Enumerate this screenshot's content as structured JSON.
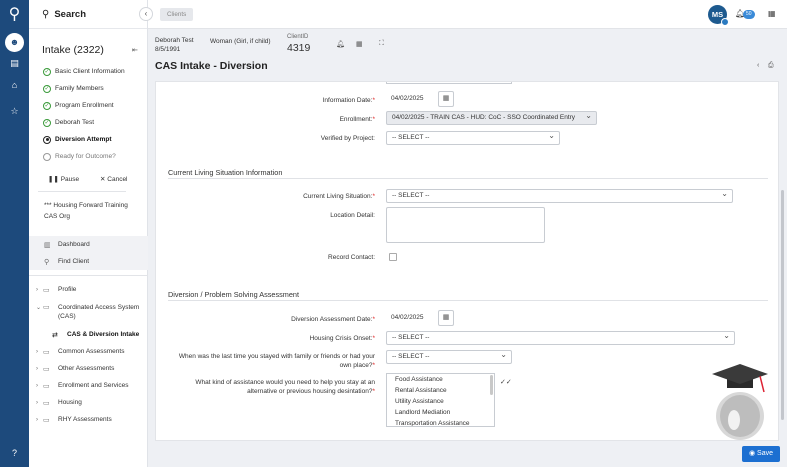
{
  "sidebar": {
    "search_label": "Search",
    "intake_title": "Intake (2322)",
    "steps": [
      {
        "label": "Basic Client Information",
        "state": "done"
      },
      {
        "label": "Family Members",
        "state": "done"
      },
      {
        "label": "Program Enrollment",
        "state": "done"
      },
      {
        "label": "Deborah Test",
        "state": "done"
      },
      {
        "label": "Diversion Attempt",
        "state": "current"
      },
      {
        "label": "Ready for Outcome?",
        "state": "pending"
      }
    ],
    "pause_label": "Pause",
    "cancel_label": "Cancel",
    "org": "*** Housing Forward Training CAS Org",
    "nav": [
      {
        "label": "Dashboard",
        "icon": "dashboard-icon"
      },
      {
        "label": "Find Client",
        "icon": "search-icon"
      }
    ],
    "tree": [
      {
        "label": "Profile",
        "expanded": false
      },
      {
        "label": "Coordinated Access System (CAS)",
        "expanded": true
      },
      {
        "label": "CAS & Diversion Intake",
        "child": true
      },
      {
        "label": "Common Assessments",
        "expanded": false
      },
      {
        "label": "Other Assessments",
        "expanded": false
      },
      {
        "label": "Enrollment and Services",
        "expanded": false
      },
      {
        "label": "Housing",
        "expanded": false
      },
      {
        "label": "RHY Assessments",
        "expanded": false
      }
    ]
  },
  "header": {
    "breadcrumb": "Clients",
    "avatar_initials": "MS",
    "notification_count": "50"
  },
  "client": {
    "name": "Deborah Test",
    "dob": "8/5/1991",
    "gender": "Woman (Girl, if child)",
    "id_label": "ClientID",
    "id_value": "4319"
  },
  "form": {
    "title": "CAS Intake - Diversion",
    "information_date": {
      "label": "Information Date:",
      "value": "04/02/2025"
    },
    "enrollment": {
      "label": "Enrollment:",
      "value": "04/02/2025 - TRAIN CAS - HUD: CoC - SSO Coordinated Entry"
    },
    "verified_by_project": {
      "label": "Verified by Project:",
      "value": "-- SELECT --"
    },
    "current_living_section": "Current Living Situation Information",
    "current_living_situation": {
      "label": "Current Living Situation:",
      "value": "-- SELECT --"
    },
    "location_detail": {
      "label": "Location Detail:"
    },
    "record_contact": {
      "label": "Record Contact:"
    },
    "diversion_section": "Diversion / Problem Solving Assessment",
    "diversion_date": {
      "label": "Diversion Assessment Date:",
      "value": "04/02/2025"
    },
    "housing_crisis": {
      "label": "Housing Crisis Onset:",
      "value": "-- SELECT --"
    },
    "last_stayed": {
      "label": "When was the last time you stayed with family or friends or had your own place?",
      "value": "-- SELECT --"
    },
    "assistance": {
      "label": "What kind of assistance would you need to help you stay at an alternative or previous housing desintation?",
      "options": [
        "Food Assistance",
        "Rental Assistance",
        "Utility Assistance",
        "Landlord Mediation",
        "Transportation Assistance"
      ]
    },
    "save_label": "Save"
  },
  "colors": {
    "rail": "#1d4a7c",
    "primary": "#1c6fd1",
    "done": "#3a9a3a",
    "required": "#dd2222"
  }
}
